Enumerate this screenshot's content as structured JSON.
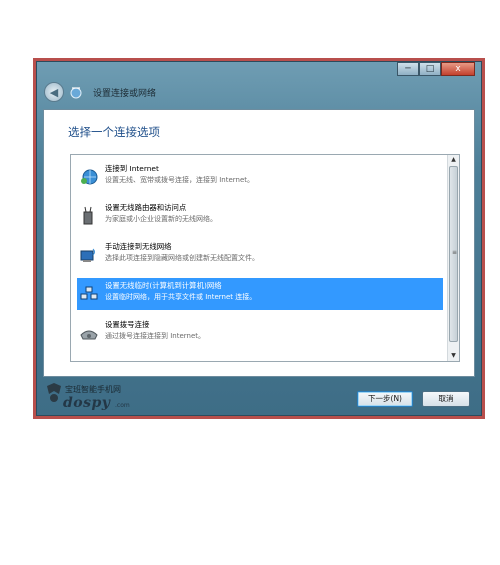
{
  "window": {
    "title": "设置连接或网络",
    "controls": {
      "minimize": "─",
      "maximize": "□",
      "close": "x"
    }
  },
  "heading": "选择一个连接选项",
  "options": [
    {
      "title": "连接到 Internet",
      "description": "设置无线、宽带或拨号连接，连接到 Internet。",
      "icon": "globe-network-icon",
      "selected": false
    },
    {
      "title": "设置无线路由器和访问点",
      "description": "为家庭或小企业设置新的无线网络。",
      "icon": "wireless-router-icon",
      "selected": false
    },
    {
      "title": "手动连接到无线网络",
      "description": "选择此项连接到隐藏网络或创建新无线配置文件。",
      "icon": "wireless-computer-icon",
      "selected": false
    },
    {
      "title": "设置无线临时(计算机到计算机)网络",
      "description": "设置临时网络，用于共享文件或 Internet 连接。",
      "icon": "adhoc-network-icon",
      "selected": true
    },
    {
      "title": "设置拨号连接",
      "description": "通过拨号连接连接到 Internet。",
      "icon": "dialup-phone-icon",
      "selected": false
    }
  ],
  "scrollbar": {
    "up": "▲",
    "down": "▼",
    "grip": "≡"
  },
  "buttons": {
    "next": "下一步(N)",
    "cancel": "取消"
  },
  "watermark": {
    "cn": "宝班智能手机网",
    "brand": "dospy",
    "domain": ".com"
  },
  "colors": {
    "selection": "#3399ff",
    "heading": "#1f4f8a",
    "frame": "#b84f4c"
  }
}
